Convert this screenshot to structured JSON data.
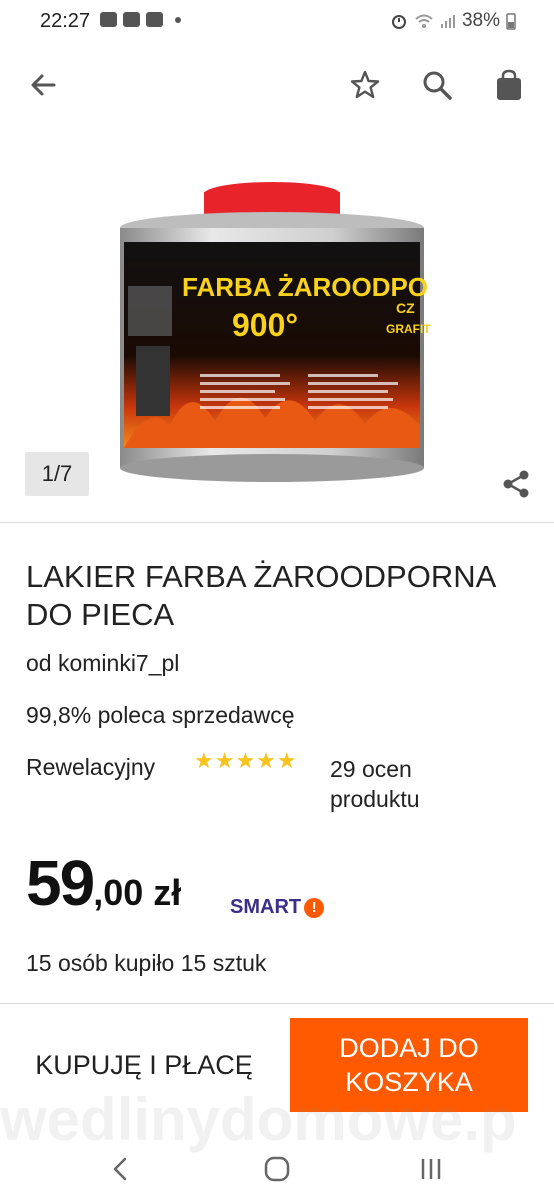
{
  "status_bar": {
    "time": "22:27",
    "battery": "38%",
    "icons": [
      "youtube-icon",
      "app-icon",
      "app-icon",
      "dot-icon",
      "alarm-icon",
      "wifi-icon",
      "signal-icon",
      "battery-icon"
    ]
  },
  "toolbar": {
    "icons": [
      "back-arrow-icon",
      "star-icon",
      "search-icon",
      "shopping-bag-icon"
    ]
  },
  "gallery": {
    "counter": "1/7",
    "product_image": {
      "label_main": "FARBA ŻAROODPO",
      "label_temp": "900°",
      "label_side": "CZ",
      "label_side2": "GRAFIT",
      "lid_color": "#e8232a"
    }
  },
  "product": {
    "title": "LAKIER FARBA ŻAROODPORNA DO PIECA",
    "seller": "od kominki7_pl",
    "recommend": "99,8% poleca sprzedawcę",
    "rating_word": "Rewelacyjny",
    "stars": "★★★★★",
    "rating_count": "29 ocen produktu",
    "price_int": "59",
    "price_dec": ",00",
    "price_currency": "zł",
    "smart_label": "SMART",
    "smart_badge": "!",
    "bought": "15 osób kupiło 15 sztuk"
  },
  "actions": {
    "buy_label": "KUPUJĘ I PŁACĘ",
    "cart_label": "DODAJ DO KOSZYKA"
  },
  "watermark": "wedlinydomowe.p",
  "colors": {
    "accent": "#ff5a00",
    "smart": "#3a2f8a",
    "stars": "#f7c31c"
  }
}
